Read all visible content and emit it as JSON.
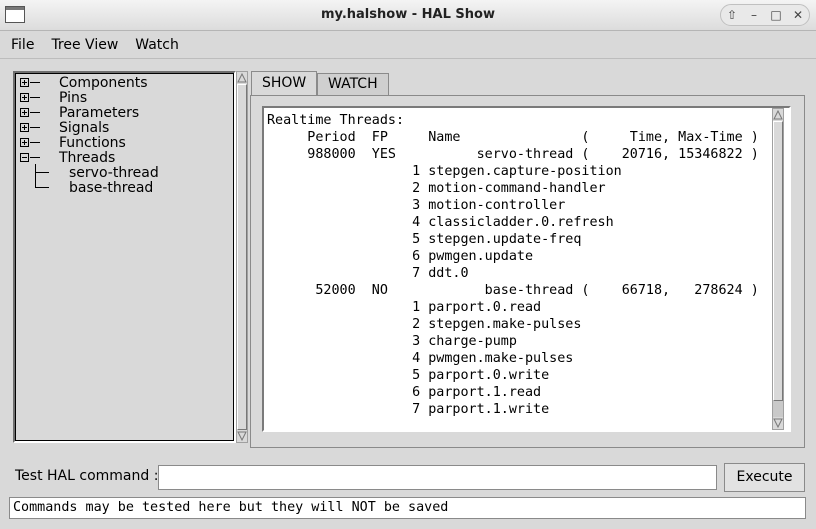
{
  "window": {
    "title": "my.halshow - HAL Show",
    "controls": [
      "up-icon",
      "minimize-icon",
      "maximize-icon",
      "close-icon"
    ]
  },
  "menu": {
    "items": [
      "File",
      "Tree View",
      "Watch"
    ]
  },
  "tree": {
    "nodes": [
      {
        "label": "Components",
        "toggle": "plus"
      },
      {
        "label": "Pins",
        "toggle": "plus"
      },
      {
        "label": "Parameters",
        "toggle": "plus"
      },
      {
        "label": "Signals",
        "toggle": "plus"
      },
      {
        "label": "Functions",
        "toggle": "plus"
      },
      {
        "label": "Threads",
        "toggle": "minus"
      }
    ],
    "children": [
      "servo-thread",
      "base-thread"
    ]
  },
  "tabs": {
    "show": "SHOW",
    "watch": "WATCH",
    "active": "SHOW"
  },
  "show_text": {
    "lines": [
      "Realtime Threads:",
      "     Period  FP     Name               (     Time, Max-Time )",
      "     988000  YES          servo-thread (    20716, 15346822 )",
      "                  1 stepgen.capture-position",
      "                  2 motion-command-handler",
      "                  3 motion-controller",
      "                  4 classicladder.0.refresh",
      "                  5 stepgen.update-freq",
      "                  6 pwmgen.update",
      "                  7 ddt.0",
      "      52000  NO            base-thread (    66718,   278624 )",
      "                  1 parport.0.read",
      "                  2 stepgen.make-pulses",
      "                  3 charge-pump",
      "                  4 pwmgen.make-pulses",
      "                  5 parport.0.write",
      "                  6 parport.1.read",
      "                  7 parport.1.write"
    ]
  },
  "command": {
    "label": "Test HAL command :",
    "value": "",
    "execute_label": "Execute"
  },
  "status": {
    "text": "Commands may be tested here but they will NOT be saved"
  }
}
